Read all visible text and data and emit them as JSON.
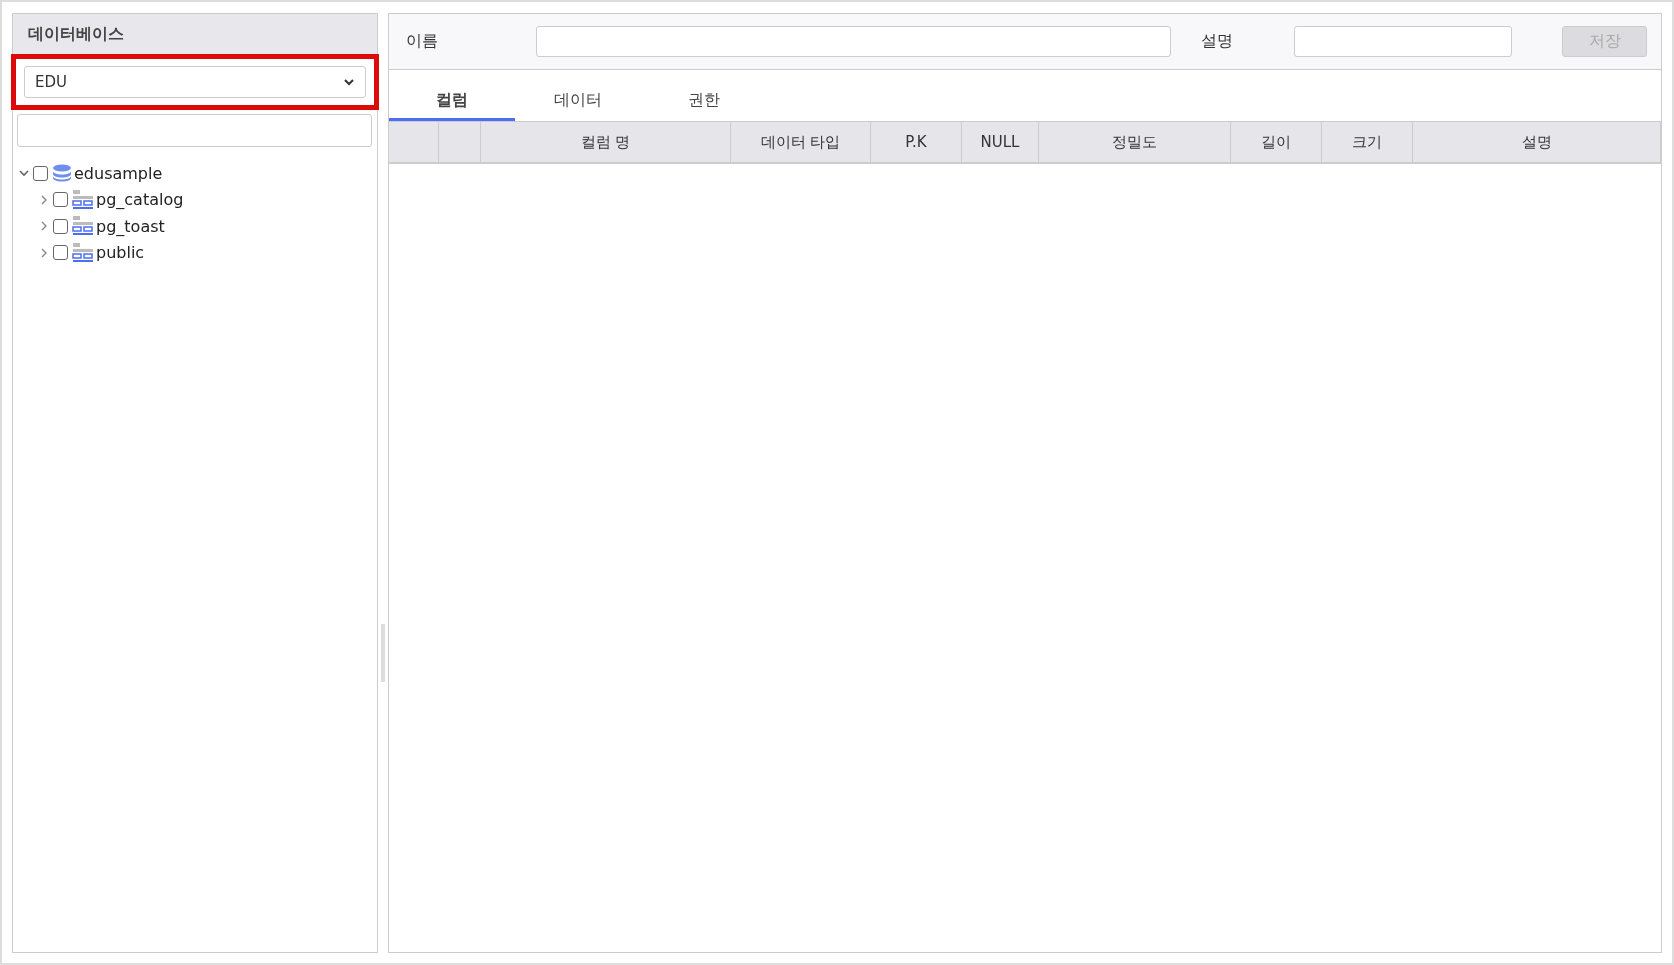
{
  "sidebar": {
    "title": "데이터베이스",
    "database_select": {
      "value": "EDU",
      "highlighted": true
    },
    "tree": [
      {
        "label": "edusample",
        "kind": "database",
        "expanded": true,
        "checked": false,
        "children": [
          {
            "label": "pg_catalog",
            "kind": "schema",
            "expanded": false,
            "checked": false
          },
          {
            "label": "pg_toast",
            "kind": "schema",
            "expanded": false,
            "checked": false
          },
          {
            "label": "public",
            "kind": "schema",
            "expanded": false,
            "checked": false
          }
        ]
      }
    ]
  },
  "form": {
    "name_label": "이름",
    "description_label": "설명",
    "save_button": {
      "label": "저장",
      "disabled": true
    }
  },
  "tabs": [
    {
      "label": "컬럼",
      "selected": true
    },
    {
      "label": "데이터",
      "selected": false
    },
    {
      "label": "권한",
      "selected": false
    }
  ],
  "table": {
    "columns": [
      null,
      null,
      "컬럼 명",
      "데이터 타입",
      "P.K",
      "NULL",
      "정밀도",
      "길이",
      "크기",
      "설명"
    ]
  }
}
